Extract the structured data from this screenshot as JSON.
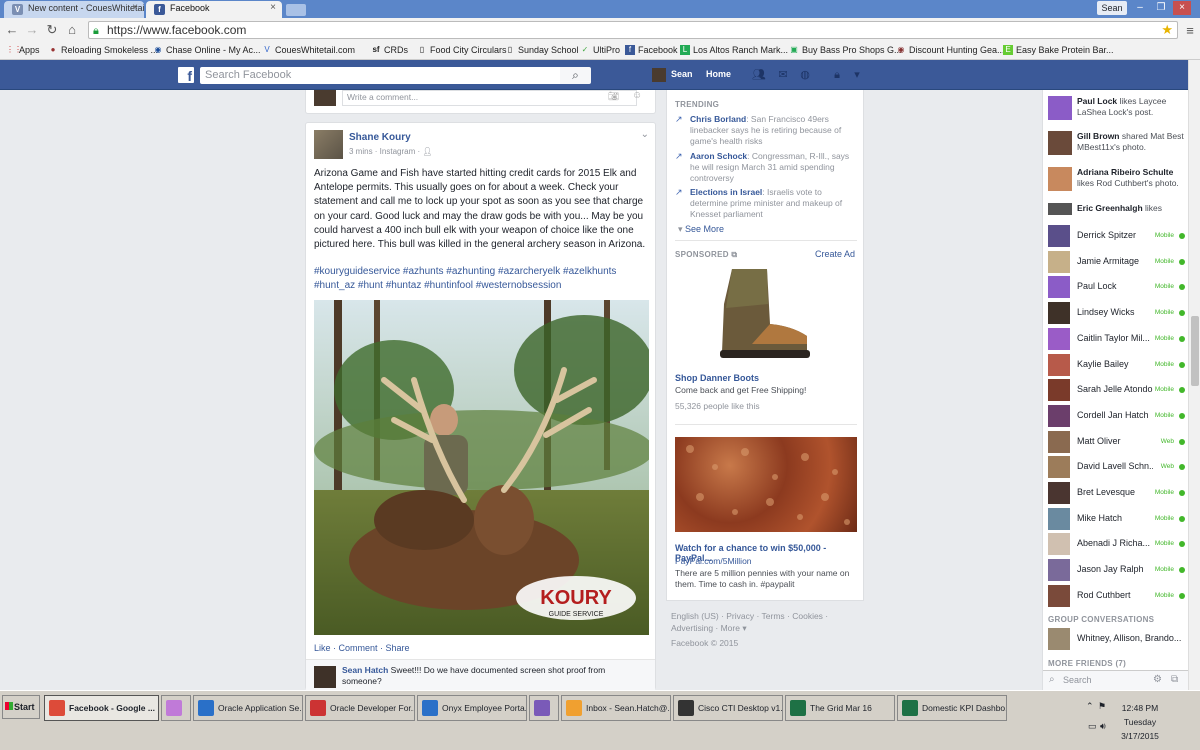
{
  "browser": {
    "tabs": [
      {
        "label": "New content - CouesWhitetail...",
        "active": false
      },
      {
        "label": "Facebook",
        "active": true
      }
    ],
    "user_button": "Sean",
    "url": "https://www.facebook.com",
    "bookmarks": [
      {
        "label": "Apps",
        "icon": "apps-grid-icon"
      },
      {
        "label": "Reloading Smokeless ...",
        "icon": "reloading-icon"
      },
      {
        "label": "Chase Online - My Ac...",
        "icon": "chase-icon"
      },
      {
        "label": "CouesWhitetail.com",
        "icon": "coues-icon"
      },
      {
        "label": "CRDs",
        "icon": "sf-icon"
      },
      {
        "label": "Food City Circulars",
        "icon": "page-icon"
      },
      {
        "label": "Sunday School",
        "icon": "page-icon"
      },
      {
        "label": "UltiPro",
        "icon": "ultipro-icon"
      },
      {
        "label": "Facebook",
        "icon": "facebook-icon"
      },
      {
        "label": "Los Altos Ranch Mark...",
        "icon": "ranch-icon"
      },
      {
        "label": "Buy Bass Pro Shops G...",
        "icon": "basspro-icon"
      },
      {
        "label": "Discount Hunting Gea...",
        "icon": "hunting-gear-icon"
      },
      {
        "label": "Easy Bake Protein Bar...",
        "icon": "easybake-icon"
      }
    ]
  },
  "fb_header": {
    "search_placeholder": "Search Facebook",
    "user_name": "Sean",
    "home_label": "Home"
  },
  "feed": {
    "comment_placeholder": "Write a comment...",
    "post": {
      "author": "Shane Koury",
      "meta": "3 mins · Instagram · ",
      "text": "Arizona Game and Fish have started hitting credit cards for 2015 Elk and Antelope permits. This usually goes on for about a week. Check your statement and call me to lock up your spot as soon as you see that charge on your card. Good luck and may the draw gods be with you... May be you could harvest a 400 inch bull elk with your weapon of choice like the one pictured here. This bull was killed in the general archery season in Arizona.",
      "hashtags": "#kouryguideservice #azhunts #azhunting #azarcheryelk #azelkhunts #hunt_az #hunt #huntaz #huntinfool #westernobsession",
      "photo_logo_main": "KOURY",
      "photo_logo_sub": "GUIDE SERVICE",
      "actions": [
        "Like",
        "Comment",
        "Share"
      ],
      "comment": {
        "author": "Sean Hatch",
        "text": " Sweet!!! Do we have documented screen shot proof from someone?"
      }
    }
  },
  "right_column": {
    "trending_title": "TRENDING",
    "trending": [
      {
        "name": "Chris Borland",
        "desc": ": San Francisco 49ers linebacker says he is retiring because of game's health risks"
      },
      {
        "name": "Aaron Schock",
        "desc": ": Congressman, R-Ill., says he will resign March 31 amid spending controversy"
      },
      {
        "name": "Elections in Israel",
        "desc": ": Israelis vote to determine prime minister and makeup of Knesset parliament"
      }
    ],
    "see_more": "See More",
    "sponsored_title": "SPONSORED",
    "create_ad": "Create Ad",
    "ads": [
      {
        "title": "Shop Danner Boots",
        "text": "Come back and get Free Shipping!",
        "likes": "55,326 people like this"
      },
      {
        "title": "Watch for a chance to win $50,000 - PayPal...",
        "link": "PayPal.com/5Million",
        "text": "There are 5 million pennies with your name on them. Time to cash in. #paypalit"
      }
    ],
    "footer": {
      "links": "English (US) · Privacy · Terms · Cookies · Advertising · More ▾",
      "copyright": "Facebook © 2015"
    }
  },
  "chat": {
    "ticker": [
      {
        "name": "Paul Lock",
        "text": " likes Laycee LaShea Lock's post."
      },
      {
        "name": "Gill Brown",
        "text": " shared Mat Best MBest11x's photo."
      },
      {
        "name": "Adriana Ribeiro Schulte",
        "text": " likes Rod Cuthbert's photo."
      },
      {
        "name": "Eric Greenhalgh",
        "text": " likes"
      }
    ],
    "friends": [
      {
        "name": "Derrick Spitzer",
        "status": "Mobile"
      },
      {
        "name": "Jamie Armitage",
        "status": "Mobile"
      },
      {
        "name": "Paul Lock",
        "status": "Mobile"
      },
      {
        "name": "Lindsey Wicks",
        "status": "Mobile"
      },
      {
        "name": "Caitlin Taylor Mil...",
        "status": "Mobile"
      },
      {
        "name": "Kaylie Bailey",
        "status": "Mobile"
      },
      {
        "name": "Sarah Jelle Atondo",
        "status": "Mobile"
      },
      {
        "name": "Cordell Jan Hatch",
        "status": "Mobile"
      },
      {
        "name": "Matt Oliver",
        "status": "Web"
      },
      {
        "name": "David Lavell Schn...",
        "status": "Web"
      },
      {
        "name": "Bret Levesque",
        "status": "Mobile"
      },
      {
        "name": "Mike Hatch",
        "status": "Mobile"
      },
      {
        "name": "Abenadi J Richa...",
        "status": "Mobile"
      },
      {
        "name": "Jason Jay Ralph",
        "status": "Mobile"
      },
      {
        "name": "Rod Cuthbert",
        "status": "Mobile"
      }
    ],
    "group_title": "GROUP CONVERSATIONS",
    "group_name": "Whitney, Allison, Brando...",
    "more_friends": "MORE FRIENDS (7)",
    "search_placeholder": "Search"
  },
  "taskbar": {
    "start": "Start",
    "tasks": [
      {
        "label": "Facebook - Google ...",
        "active": true,
        "icon": "chrome-icon"
      },
      {
        "label": "",
        "active": false,
        "icon": "messenger-icon"
      },
      {
        "label": "Oracle Application Se...",
        "active": false,
        "icon": "ie-icon"
      },
      {
        "label": "Oracle Developer For...",
        "active": false,
        "icon": "oracle-icon"
      },
      {
        "label": "Onyx Employee Porta...",
        "active": false,
        "icon": "ie-icon"
      },
      {
        "label": "",
        "active": false,
        "icon": "app-icon"
      },
      {
        "label": "Inbox - Sean.Hatch@...",
        "active": false,
        "icon": "outlook-icon"
      },
      {
        "label": "Cisco CTI Desktop v1...",
        "active": false,
        "icon": "cisco-icon"
      },
      {
        "label": "The Grid Mar 16",
        "active": false,
        "icon": "excel-icon"
      },
      {
        "label": "Domestic KPI Dashbo...",
        "active": false,
        "icon": "excel-icon"
      }
    ],
    "clock": {
      "time": "12:48 PM",
      "day": "Tuesday",
      "date": "3/17/2015"
    }
  },
  "colors": {
    "fb_blue": "#3b5998",
    "link_blue": "#365899",
    "online_green": "#42b72a"
  }
}
